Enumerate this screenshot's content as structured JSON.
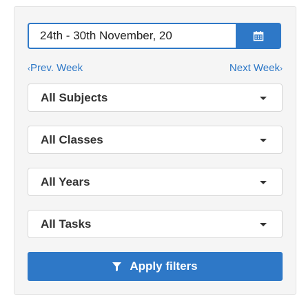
{
  "date_picker": {
    "value": "24th - 30th November, 20",
    "icon": "calendar-icon"
  },
  "week_nav": {
    "prev_label": "Prev. Week",
    "next_label": "Next Week",
    "prev_icon": "chevron-left-icon",
    "next_icon": "chevron-right-icon"
  },
  "filters": {
    "subjects": "All Subjects",
    "classes": "All Classes",
    "years": "All Years",
    "tasks": "All Tasks"
  },
  "apply_button": {
    "label": "Apply filters",
    "icon": "filter-icon"
  },
  "colors": {
    "accent": "#2e78c7",
    "panel_bg": "#f5f5f5"
  }
}
